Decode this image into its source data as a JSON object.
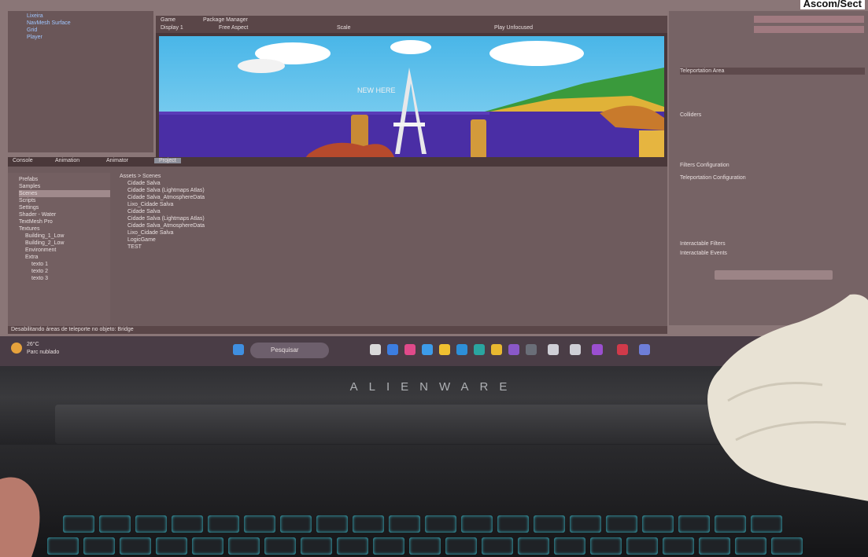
{
  "photo_credit": "Ascom/Sect",
  "laptop": {
    "brand": "ALIENWARE"
  },
  "unity": {
    "hierarchy_items": [
      "Lixeira",
      "NavMesh Surface",
      "Grid",
      "Player"
    ],
    "tabs": {
      "scene": "Game",
      "package_manager": "Package Manager",
      "display": "Display 1",
      "aspect": "Free Aspect",
      "scale": "Scale",
      "play_mode": "Play Unfocused"
    },
    "scene_sign_text": "NEW HERE",
    "inspector_headers": [
      "Teleportation Area",
      "Colliders",
      "Filters Configuration",
      "Teleportation Configuration",
      "Interactable Filters",
      "Interactable Events"
    ],
    "project_tabs": [
      "Console",
      "Animation",
      "Animator",
      "Project"
    ],
    "project_breadcrumb": "Assets > Scenes",
    "folders": [
      "Prefabs",
      "Samples",
      "Scenes",
      "Scripts",
      "Settings",
      "Shader - Water",
      "TextMesh Pro",
      "Textures",
      "Building_1_Low",
      "Building_2_Low",
      "Environment",
      "Extra",
      "texto 1",
      "texto 2",
      "texto 3"
    ],
    "files": [
      "Cidade Salva",
      "Cidade Salva (Lightmaps Atlas)",
      "Cidade Salva_AtmosphereData",
      "Lixo_Cidade Salva",
      "Cidade Salva",
      "Cidade Salva (Lightmaps Atlas)",
      "Cidade Salva_AtmosphereData",
      "Lixo_Cidade Salva",
      "LogicGame",
      "TEST"
    ],
    "status_text": "Desabilitando áreas de teleporte no objeto: Bridge"
  },
  "taskbar": {
    "search_placeholder": "Pesquisar",
    "weather": "26°C",
    "weather_desc": "Parc nublado"
  }
}
